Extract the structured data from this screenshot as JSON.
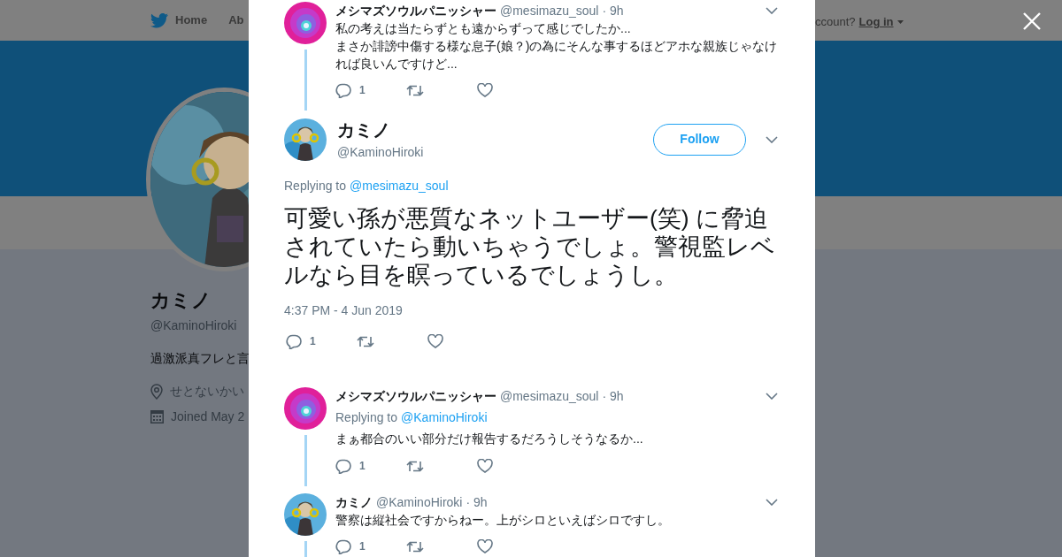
{
  "background_page": {
    "nav": {
      "items": [
        {
          "label": "Home",
          "kind": "home"
        },
        {
          "label": "Ab",
          "kind": "plain"
        }
      ],
      "login_prompt": "ccount?",
      "login": "Log in"
    },
    "profile": {
      "name": "カミノ",
      "handle": "@KaminoHiroki",
      "bio": "過激派真フレと言",
      "location": "せとないかい",
      "joined": "Joined May 2"
    }
  },
  "modal": {
    "tweets": [
      {
        "kind": "reply",
        "name": "メシマズソウルパニッシャー",
        "handle": "@mesimazu_soul",
        "time": "· 9h",
        "text_lines": [
          "私の考えは当たらずとも遠からずって感じでしたか...",
          "まさか誹謗中傷する様な息子(娘？)の為にそんな事するほどアホな親族じゃなければ良いんですけど..."
        ],
        "reply_count": "1"
      },
      {
        "kind": "focused",
        "name": "カミノ",
        "handle": "@KaminoHiroki",
        "follow": "Follow",
        "replying_label": "Replying to",
        "replying_to": "@mesimazu_soul",
        "text_lines": [
          "可愛い孫が悪質なネットユーザー(笑) に脅迫されていたら動いちゃうでしょ。警視監レベルなら目を瞑っているでしょうし。"
        ],
        "timestamp": "4:37 PM - 4 Jun 2019",
        "reply_count": "1"
      },
      {
        "kind": "reply",
        "name": "メシマズソウルパニッシャー",
        "handle": "@mesimazu_soul",
        "time": "· 9h",
        "replying_label": "Replying to",
        "replying_to": "@KaminoHiroki",
        "text_lines": [
          "まぁ都合のいい部分だけ報告するだろうしそうなるか..."
        ],
        "reply_count": "1"
      },
      {
        "kind": "reply",
        "name": "カミノ",
        "handle": "@KaminoHiroki",
        "time": "· 9h",
        "text_lines": [
          "警察は縦社会ですからねー。上がシロといえばシロですし。"
        ],
        "reply_count": "1"
      }
    ]
  }
}
